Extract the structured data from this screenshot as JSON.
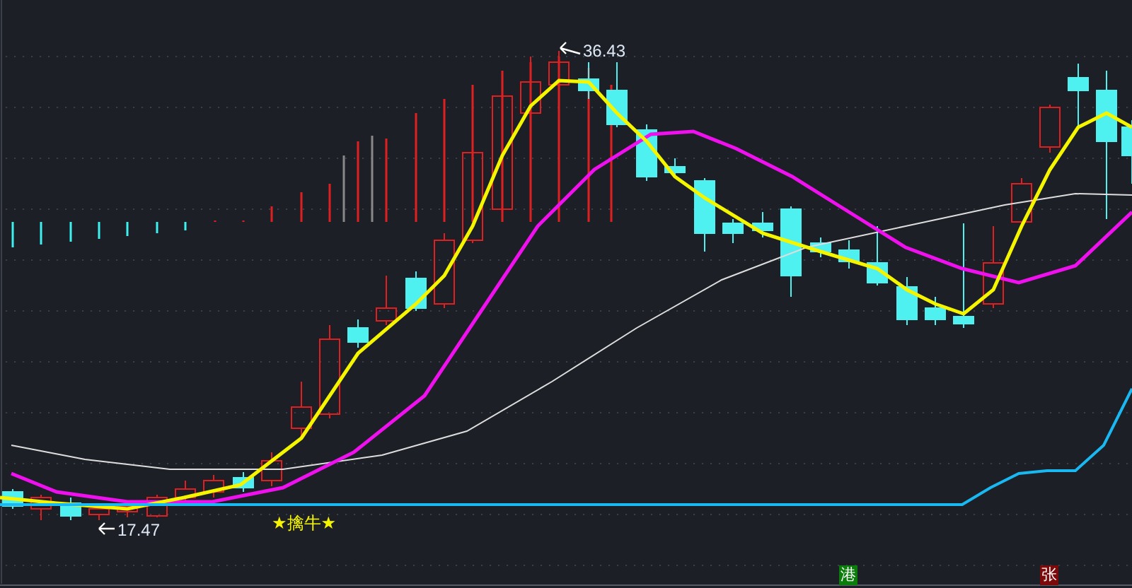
{
  "price_labels": [
    {
      "kind": "high",
      "text": "36.43"
    },
    {
      "kind": "low",
      "text": "17.47"
    }
  ],
  "signal": {
    "text": "★擒牛★"
  },
  "badges": [
    {
      "text": "港",
      "color": "#0b7d0b"
    },
    {
      "text": "张",
      "color": "#7d0a0a"
    }
  ]
}
